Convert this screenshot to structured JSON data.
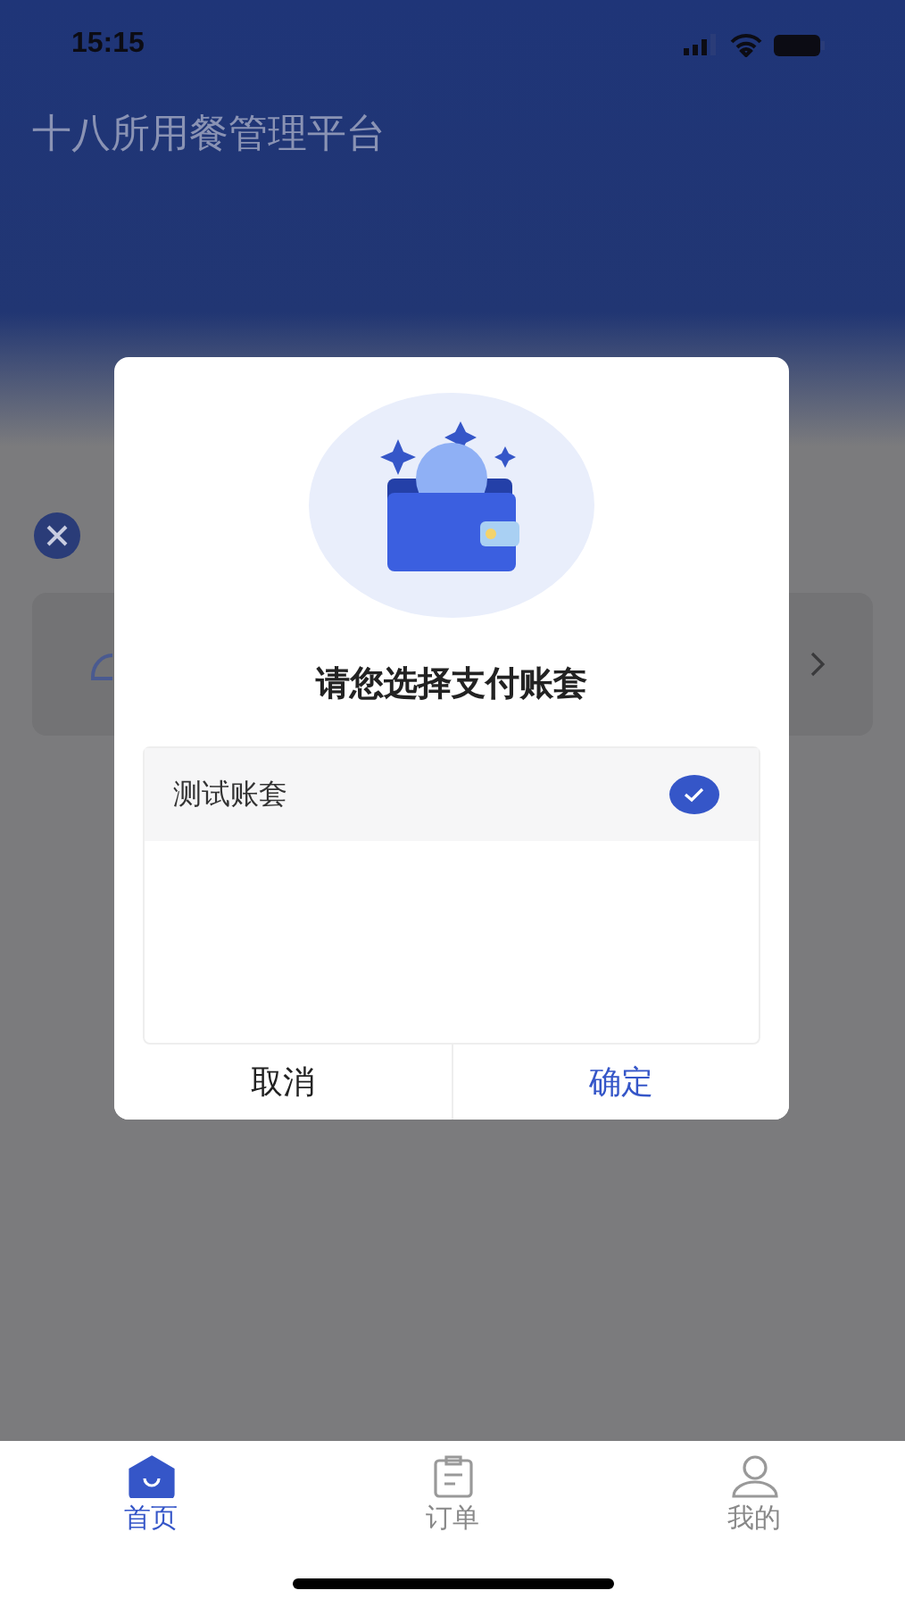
{
  "status_bar": {
    "time": "15:15"
  },
  "header": {
    "title": "十八所用餐管理平台"
  },
  "dialog": {
    "title": "请您选择支付账套",
    "options": [
      {
        "label": "测试账套",
        "selected": true
      }
    ],
    "buttons": [
      {
        "label": "取消",
        "kind": "cancel"
      },
      {
        "label": "确定",
        "kind": "confirm"
      }
    ]
  },
  "tab_bar": [
    {
      "label": "首页",
      "selected": true,
      "kind": "home"
    },
    {
      "label": "订单",
      "selected": false,
      "kind": "orders"
    },
    {
      "label": "我的",
      "selected": false,
      "kind": "profile"
    }
  ]
}
